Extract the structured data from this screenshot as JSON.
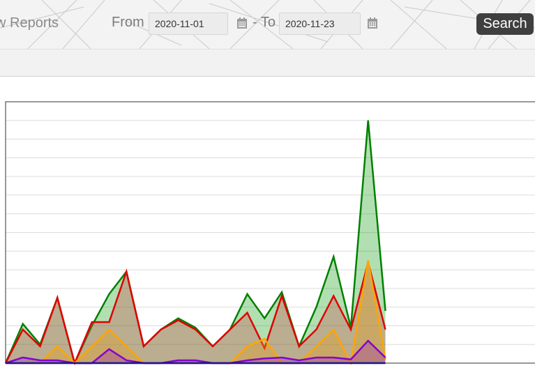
{
  "header": {
    "title": "w Reports",
    "from_label": "From",
    "to_label": "- To",
    "from_date": "2020-11-01",
    "to_date": "2020-11-23",
    "search_label": "Search"
  },
  "chart_data": {
    "type": "area",
    "x": [
      1,
      2,
      3,
      4,
      5,
      6,
      7,
      8,
      9,
      10,
      11,
      12,
      13,
      14,
      15,
      16,
      17,
      18,
      19,
      20,
      21,
      22,
      23,
      24,
      25,
      26,
      27,
      28,
      29,
      30,
      31,
      32,
      33
    ],
    "ylim": [
      0,
      14
    ],
    "grid": true,
    "series": [
      {
        "color": "#008000",
        "fill": "rgba(0,150,0,0.30)",
        "values": [
          0,
          2.1,
          1.0,
          3.5,
          0,
          2.0,
          3.7,
          4.9,
          0.9,
          1.8,
          2.4,
          1.9,
          0.9,
          1.8,
          3.7,
          2.4,
          3.8,
          0.9,
          3.0,
          5.7,
          1.9,
          13.0,
          2.8
        ]
      },
      {
        "color": "#e00000",
        "fill": "rgba(200,80,80,0.35)",
        "values": [
          0,
          1.8,
          0.9,
          3.5,
          0,
          2.2,
          2.2,
          4.9,
          0.9,
          1.8,
          2.3,
          1.8,
          0.9,
          1.8,
          2.7,
          0.8,
          3.6,
          0.9,
          1.8,
          3.6,
          1.8,
          5.4,
          1.8
        ]
      },
      {
        "color": "#ffa500",
        "fill": "rgba(230,160,30,0.35)",
        "values": [
          0,
          0,
          0,
          0.9,
          0,
          0.9,
          1.8,
          0.9,
          0,
          0,
          0,
          0,
          0,
          0,
          0.9,
          1.3,
          0,
          0,
          0.9,
          1.8,
          0,
          5.5,
          0.2
        ]
      },
      {
        "color": "#8800cc",
        "fill": "rgba(140,0,200,0.25)",
        "values": [
          0,
          0.3,
          0.15,
          0.15,
          0,
          0,
          0.75,
          0.15,
          0,
          0,
          0.15,
          0.15,
          0,
          0,
          0.15,
          0.25,
          0.3,
          0.15,
          0.3,
          0.3,
          0.2,
          1.2,
          0.3
        ]
      },
      {
        "color": "#0000cc",
        "fill": "rgba(0,0,200,0.0)",
        "values": [
          0,
          0,
          0,
          0,
          0,
          0,
          0,
          0,
          0,
          0,
          0,
          0,
          0,
          0,
          0,
          0,
          0,
          0,
          0,
          0,
          0,
          0,
          0
        ]
      }
    ]
  }
}
